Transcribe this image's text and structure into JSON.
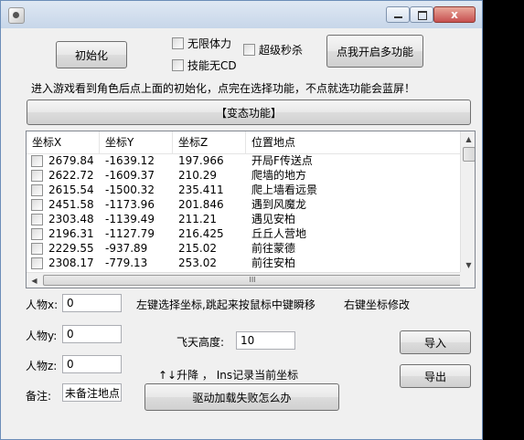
{
  "window": {
    "close_glyph": "x"
  },
  "top": {
    "init_button": "初始化",
    "chk_unlimited_stamina": "无限体力",
    "chk_skill_no_cd": "技能无CD",
    "chk_super_kill": "超级秒杀",
    "multi_button": "点我开启多功能",
    "instruction": "进入游戏看到角色后点上面的初始化，点完在选择功能，不点就选功能会蓝屏！",
    "freak_button": "【变态功能】"
  },
  "list": {
    "headers": [
      "坐标X",
      "坐标Y",
      "坐标Z",
      "位置地点"
    ],
    "rows": [
      {
        "x": "2679.84",
        "y": "-1639.12",
        "z": "197.966",
        "place": "开局F传送点"
      },
      {
        "x": "2622.72",
        "y": "-1609.37",
        "z": "210.29",
        "place": "爬墙的地方"
      },
      {
        "x": "2615.54",
        "y": "-1500.32",
        "z": "235.411",
        "place": "爬上墙看远景"
      },
      {
        "x": "2451.58",
        "y": "-1173.96",
        "z": "201.846",
        "place": "遇到风魔龙"
      },
      {
        "x": "2303.48",
        "y": "-1139.49",
        "z": "211.21",
        "place": "遇见安柏"
      },
      {
        "x": "2196.31",
        "y": "-1127.79",
        "z": "216.425",
        "place": "丘丘人营地"
      },
      {
        "x": "2229.55",
        "y": "-937.89",
        "z": "215.02",
        "place": "前往蒙德"
      },
      {
        "x": "2308.17",
        "y": "-779.13",
        "z": "253.02",
        "place": "前往安柏"
      }
    ],
    "scroll_grip": "III"
  },
  "coords": {
    "x_label": "人物x:",
    "x_value": "0",
    "y_label": "人物y:",
    "y_value": "0",
    "z_label": "人物z:",
    "z_value": "0",
    "note_label": "备注:",
    "note_value": "未备注地点"
  },
  "hints": {
    "left_click": "左键选择坐标,跳起来按鼠标中键瞬移",
    "right_click": "右键坐标修改",
    "fly_label": "飞天高度:",
    "fly_value": "10",
    "updown": "↑↓升降 ， Ins记录当前坐标"
  },
  "buttons": {
    "import": "导入",
    "export": "导出",
    "driver_fail": "驱动加载失败怎么办"
  }
}
